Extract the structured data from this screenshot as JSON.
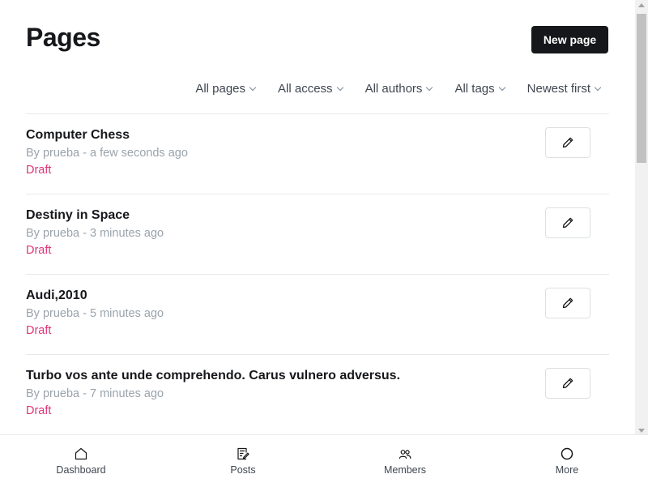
{
  "header": {
    "title": "Pages",
    "new_page_label": "New page"
  },
  "filters": [
    {
      "label": "All pages"
    },
    {
      "label": "All access"
    },
    {
      "label": "All authors"
    },
    {
      "label": "All tags"
    },
    {
      "label": "Newest first"
    }
  ],
  "pages": [
    {
      "title": "Computer Chess",
      "meta": "By prueba - a few seconds ago",
      "status": "Draft"
    },
    {
      "title": "Destiny in Space",
      "meta": "By prueba - 3 minutes ago",
      "status": "Draft"
    },
    {
      "title": "Audi,2010",
      "meta": "By prueba - 5 minutes ago",
      "status": "Draft"
    },
    {
      "title": "Turbo vos ante unde comprehendo. Carus vulnero adversus.",
      "meta": "By prueba - 7 minutes ago",
      "status": "Draft"
    }
  ],
  "bottom_nav": [
    {
      "label": "Dashboard",
      "icon": "home-icon"
    },
    {
      "label": "Posts",
      "icon": "posts-icon"
    },
    {
      "label": "Members",
      "icon": "members-icon"
    },
    {
      "label": "More",
      "icon": "more-icon"
    }
  ],
  "colors": {
    "primary_button": "#15171a",
    "draft_status": "#e0357a",
    "meta_text": "#9aa3ab",
    "divider": "#e6e9eb"
  }
}
